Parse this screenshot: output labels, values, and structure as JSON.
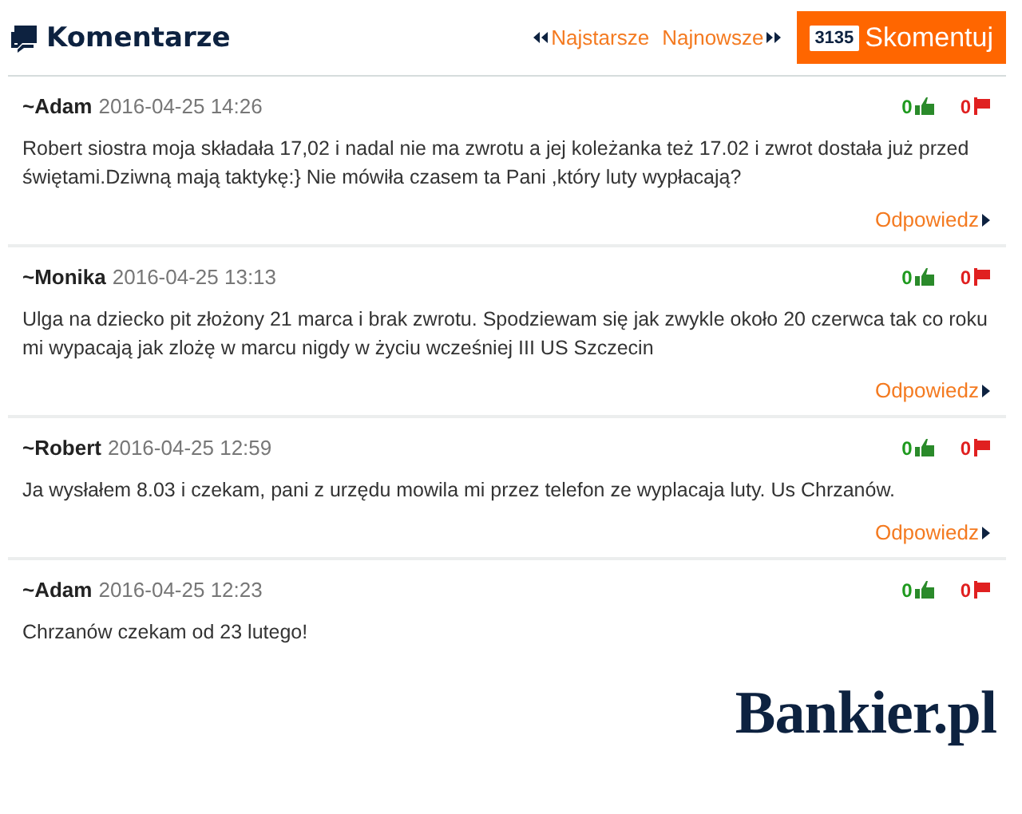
{
  "header": {
    "title": "Komentarze",
    "nav": [
      {
        "label": "Najstarsze",
        "kind": "prev"
      },
      {
        "label": "Najnowsze",
        "kind": "next"
      }
    ],
    "comment_button": {
      "count": "3135",
      "label": "Skomentuj"
    }
  },
  "comments": [
    {
      "author": "~Adam",
      "date": "2016-04-25 14:26",
      "likes": "0",
      "dislikes": "0",
      "text": "Robert siostra moja składała 17,02 i nadal nie ma zwrotu a jej koleżanka też 17.02 i zwrot dostała już przed świętami.Dziwną mają taktykę:} Nie mówiła czasem ta Pani ,który luty wypłacają?",
      "reply": "Odpowiedz"
    },
    {
      "author": "~Monika",
      "date": "2016-04-25 13:13",
      "likes": "0",
      "dislikes": "0",
      "text": "Ulga na dziecko pit złożony 21 marca i brak zwrotu. Spodziewam się jak zwykle około 20 czerwca tak co roku mi wypacają jak zlożę w marcu nigdy w życiu wcześniej III US Szczecin",
      "reply": "Odpowiedz"
    },
    {
      "author": "~Robert",
      "date": "2016-04-25 12:59",
      "likes": "0",
      "dislikes": "0",
      "text": "Ja wysłałem 8.03 i czekam, pani z urzędu mowila mi przez telefon ze wyplacaja luty. Us Chrzanów.",
      "reply": "Odpowiedz"
    },
    {
      "author": "~Adam",
      "date": "2016-04-25 12:23",
      "likes": "0",
      "dislikes": "0",
      "text": "Chrzanów czekam od 23 lutego!"
    }
  ],
  "logo": "Bankier.pl"
}
